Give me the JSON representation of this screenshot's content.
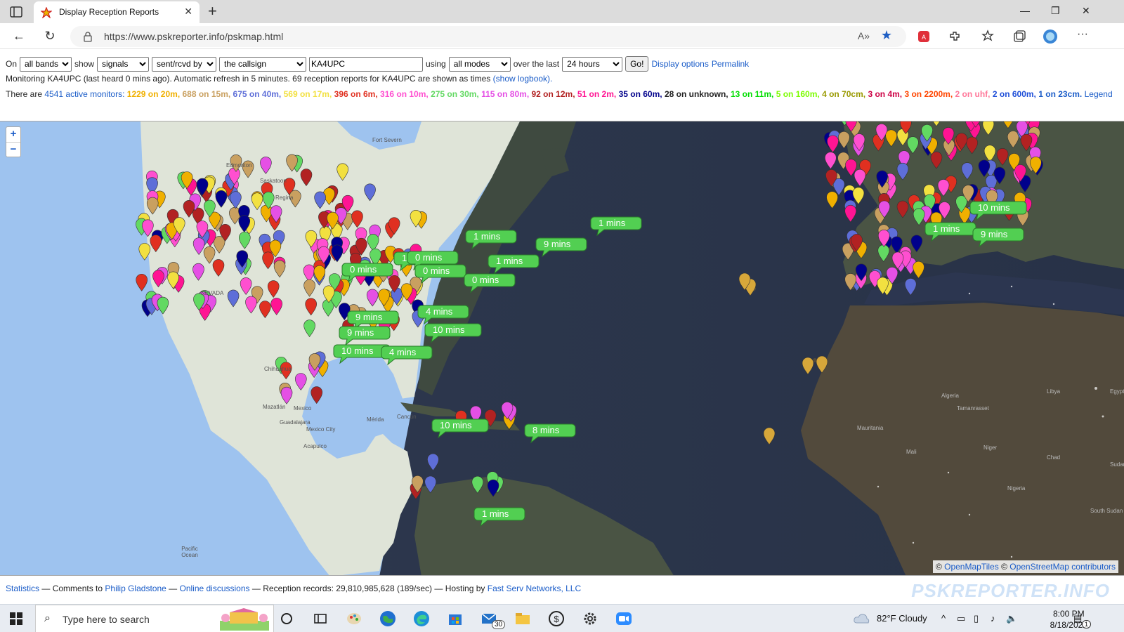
{
  "browser": {
    "tab_title": "Display Reception Reports",
    "url": "https://www.pskreporter.info/pskmap.html"
  },
  "form": {
    "on_label": "On",
    "bands_value": "all bands",
    "show_label": "show",
    "signals_value": "signals",
    "sent_value": "sent/rcvd by",
    "callsign_type_value": "the callsign",
    "callsign_input": "KA4UPC",
    "using_label": "using",
    "modes_value": "all modes",
    "over_label": "over the last",
    "period_value": "24 hours",
    "go_label": "Go!",
    "display_options": "Display options",
    "permalink": "Permalink"
  },
  "monitoring": {
    "text": "Monitoring KA4UPC (last heard 0 mins ago). Automatic refresh in 5 minutes. 69 reception reports for KA4UPC are shown as times",
    "logbook": "(show logbook)."
  },
  "monitors": {
    "prefix": "There are",
    "active": "4541 active monitors:",
    "bands": [
      {
        "text": "1229 on 20m",
        "color": "#f0b000"
      },
      {
        "text": "688 on 15m",
        "color": "#c9a060"
      },
      {
        "text": "675 on 40m",
        "color": "#5e6ed8"
      },
      {
        "text": "569 on 17m",
        "color": "#f2e040"
      },
      {
        "text": "396 on 6m",
        "color": "#e03020"
      },
      {
        "text": "316 on 10m",
        "color": "#ff4fd0"
      },
      {
        "text": "275 on 30m",
        "color": "#62d962"
      },
      {
        "text": "115 on 80m",
        "color": "#e550e5"
      },
      {
        "text": "92 on 12m",
        "color": "#b22222"
      },
      {
        "text": "51 on 2m",
        "color": "#ff1493"
      },
      {
        "text": "35 on 60m",
        "color": "#00008b"
      },
      {
        "text": "28 on unknown",
        "color": "#222222"
      },
      {
        "text": "13 on 11m",
        "color": "#00dd00"
      },
      {
        "text": "5 on 160m",
        "color": "#7cfc00"
      },
      {
        "text": "4 on 70cm",
        "color": "#999900"
      },
      {
        "text": "3 on 4m",
        "color": "#cc0044"
      },
      {
        "text": "3 on 2200m",
        "color": "#ff4500"
      },
      {
        "text": "2 on uhf",
        "color": "#ff7799"
      },
      {
        "text": "2 on 600m",
        "color": "#1f4fd8"
      },
      {
        "text": "1 on 23cm.",
        "color": "#1a5cc8"
      }
    ],
    "legend": "Legend"
  },
  "map": {
    "zoom_in": "+",
    "zoom_out": "−",
    "place_labels": [
      {
        "id": "fort-severn",
        "text": "Fort Severn"
      },
      {
        "id": "edmonton",
        "text": "Edmonton"
      },
      {
        "id": "saskatoon",
        "text": "Saskatoon"
      },
      {
        "id": "regina",
        "text": "Regina"
      },
      {
        "id": "nevada",
        "text": "NEVADA"
      },
      {
        "id": "chihuahua",
        "text": "Chihuahua"
      },
      {
        "id": "mazatlan",
        "text": "Mazatlán"
      },
      {
        "id": "guadalajara",
        "text": "Guadalajara"
      },
      {
        "id": "mexico-city",
        "text": "Mexico City"
      },
      {
        "id": "acapulco",
        "text": "Acapulco"
      },
      {
        "id": "merida",
        "text": "Mérida"
      },
      {
        "id": "cancun",
        "text": "Cancún"
      },
      {
        "id": "pacific",
        "text": "Pacific Ocean"
      },
      {
        "id": "mauritania",
        "text": "Mauritania"
      },
      {
        "id": "mali",
        "text": "Mali"
      },
      {
        "id": "niger",
        "text": "Niger"
      },
      {
        "id": "chad",
        "text": "Chad"
      },
      {
        "id": "sudan",
        "text": "Sudan"
      },
      {
        "id": "egypt",
        "text": "Egypt"
      },
      {
        "id": "libya",
        "text": "Libya"
      },
      {
        "id": "algeria",
        "text": "Algeria"
      },
      {
        "id": "nigeria",
        "text": "Nigeria"
      },
      {
        "id": "tamanrasset",
        "text": "Tamanrasset"
      },
      {
        "id": "south-sudan",
        "text": "South Sudan"
      },
      {
        "id": "mexico",
        "text": "Mexico"
      }
    ],
    "time_labels": [
      {
        "id": "t1",
        "text": "1 mins"
      },
      {
        "id": "t2",
        "text": "1 mins"
      },
      {
        "id": "t3",
        "text": "9 mins"
      },
      {
        "id": "t4",
        "text": "0 mins"
      },
      {
        "id": "t5",
        "text": "1 mins"
      },
      {
        "id": "t6",
        "text": "0 mins"
      },
      {
        "id": "t7",
        "text": "0 mins"
      },
      {
        "id": "t8",
        "text": "1 mins"
      },
      {
        "id": "t9",
        "text": "0 mins"
      },
      {
        "id": "t10",
        "text": "9 mins"
      },
      {
        "id": "t11",
        "text": "4 mins"
      },
      {
        "id": "t12",
        "text": "10 mins"
      },
      {
        "id": "t13",
        "text": "9 mins"
      },
      {
        "id": "t14",
        "text": "10 mins"
      },
      {
        "id": "t15",
        "text": "4 mins"
      },
      {
        "id": "t16",
        "text": "10 mins"
      },
      {
        "id": "t17",
        "text": "8 mins"
      },
      {
        "id": "t18",
        "text": "1 mins"
      },
      {
        "id": "t19",
        "text": "10 mins"
      },
      {
        "id": "t20",
        "text": "1 mins"
      },
      {
        "id": "t21",
        "text": "9 mins"
      },
      {
        "id": "t22",
        "text": "1 mins"
      }
    ],
    "attribution_1": "OpenMapTiles",
    "attribution_2": "OpenStreetMap contributors"
  },
  "footer": {
    "statistics": "Statistics",
    "comments": "— Comments to",
    "author": "Philip Gladstone",
    "sep": "—",
    "discussions": "Online discussions",
    "records": "— Reception records: 29,810,985,628 (189/sec) — Hosting by",
    "host": "Fast Serv Networks, LLC",
    "brand": "PSKREPORTER.INFO"
  },
  "taskbar": {
    "search_placeholder": "Type here to search",
    "mail_badge": "30",
    "weather": "82°F  Cloudy",
    "time": "8:00 PM",
    "date": "8/18/2022",
    "notif_badge": "1"
  }
}
